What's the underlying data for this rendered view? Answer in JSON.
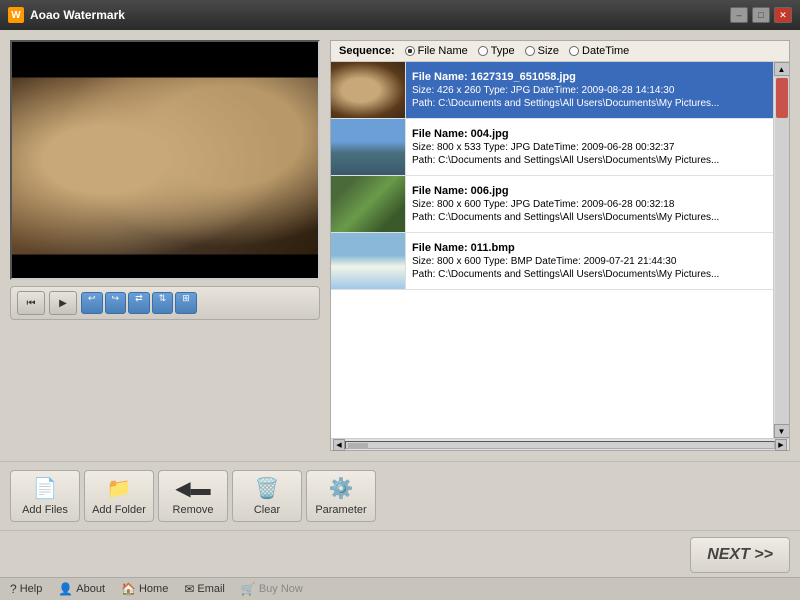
{
  "titleBar": {
    "title": "Aoao Watermark",
    "icon": "W",
    "minimizeLabel": "–",
    "maximizeLabel": "□",
    "closeLabel": "✕"
  },
  "sequence": {
    "label": "Sequence:",
    "options": [
      {
        "label": "File Name",
        "checked": true
      },
      {
        "label": "Type",
        "checked": false
      },
      {
        "label": "Size",
        "checked": false
      },
      {
        "label": "DateTime",
        "checked": false
      }
    ]
  },
  "fileList": {
    "items": [
      {
        "name": "File Name: 1627319_651058.jpg",
        "meta": "Size: 426 x 260    Type: JPG    DateTime: 2009-08-28 14:14:30",
        "path": "Path: C:\\Documents and Settings\\All Users\\Documents\\My Pictures...",
        "selected": true,
        "thumbClass": "thumb-1"
      },
      {
        "name": "File Name: 004.jpg",
        "meta": "Size: 800 x 533    Type: JPG    DateTime: 2009-06-28 00:32:37",
        "path": "Path: C:\\Documents and Settings\\All Users\\Documents\\My Pictures...",
        "selected": false,
        "thumbClass": "thumb-2"
      },
      {
        "name": "File Name: 006.jpg",
        "meta": "Size: 800 x 600    Type: JPG    DateTime: 2009-06-28 00:32:18",
        "path": "Path: C:\\Documents and Settings\\All Users\\Documents\\My Pictures...",
        "selected": false,
        "thumbClass": "thumb-3"
      },
      {
        "name": "File Name: 011.bmp",
        "meta": "Size: 800 x 600    Type: BMP    DateTime: 2009-07-21 21:44:30",
        "path": "Path: C:\\Documents and Settings\\All Users\\Documents\\My Pictures...",
        "selected": false,
        "thumbClass": "thumb-4"
      }
    ]
  },
  "controls": {
    "prevLabel": "⏮",
    "playLabel": "▶",
    "buttons": [
      "↩",
      "↪",
      "≤",
      "▤",
      "⊞"
    ]
  },
  "toolbar": {
    "addFiles": "Add Files",
    "addFolder": "Add Folder",
    "remove": "Remove",
    "clear": "Clear",
    "parameter": "Parameter"
  },
  "footer": {
    "help": "Help",
    "about": "About",
    "home": "Home",
    "email": "Email",
    "buyNow": "Buy Now"
  },
  "nextBtn": "NEXT >>"
}
